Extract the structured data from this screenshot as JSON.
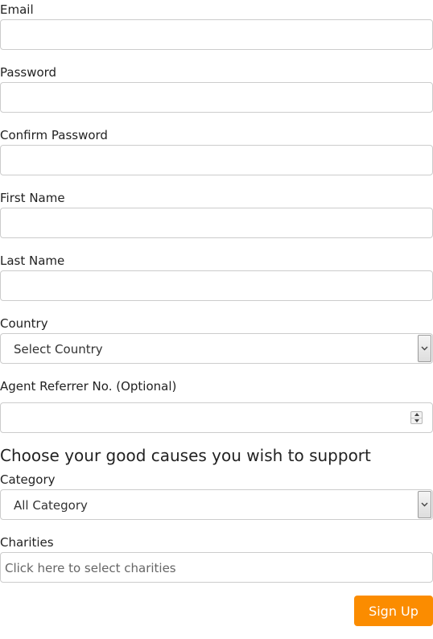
{
  "form": {
    "email": {
      "label": "Email",
      "value": ""
    },
    "password": {
      "label": "Password",
      "value": ""
    },
    "confirm_password": {
      "label": "Confirm Password",
      "value": ""
    },
    "first_name": {
      "label": "First Name",
      "value": ""
    },
    "last_name": {
      "label": "Last Name",
      "value": ""
    },
    "country": {
      "label": "Country",
      "selected": "Select Country"
    },
    "agent_referrer": {
      "label": "Agent Referrer No. (Optional)",
      "value": ""
    },
    "causes_heading": "Choose your good causes you wish to support",
    "category": {
      "label": "Category",
      "selected": "All Category"
    },
    "charities": {
      "label": "Charities",
      "placeholder": "Click here to select charities"
    },
    "submit_label": "Sign Up"
  },
  "colors": {
    "accent": "#fb8c00",
    "border": "#cccccc"
  },
  "icons": {
    "select_arrow": "chevron-down-icon",
    "spinner": "number-spinner-icon"
  }
}
